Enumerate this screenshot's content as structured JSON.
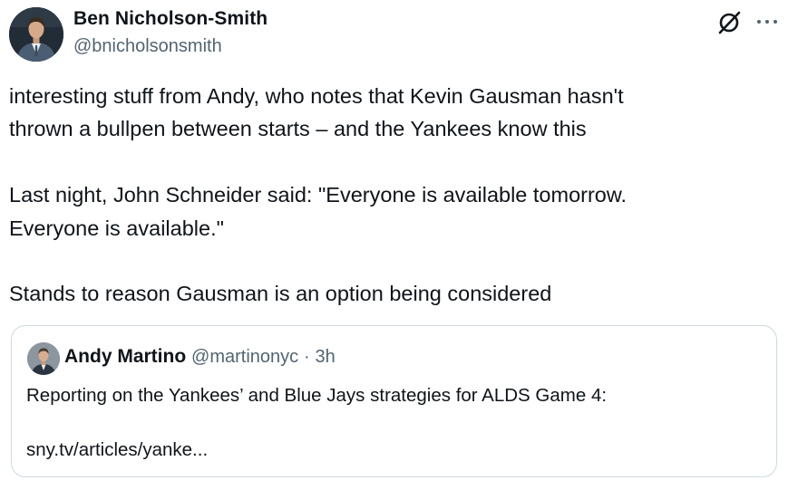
{
  "author": {
    "name": "Ben Nicholson-Smith",
    "handle": "@bnicholsonsmith"
  },
  "header_icons": {
    "grok": "grok-icon",
    "more": "more-icon"
  },
  "tweet": {
    "text": "interesting stuff from Andy, who notes that Kevin Gausman hasn't\nthrown a bullpen between starts – and the Yankees know this\n\nLast night, John Schneider said: \"Everyone is available tomorrow.\nEveryone is available.\"\n\nStands to reason Gausman is an option being considered"
  },
  "quote": {
    "name": "Andy Martino",
    "handle": "@martinonyc",
    "separator": "·",
    "time": "3h",
    "text": "Reporting on the Yankees’ and Blue Jays strategies for ALDS Game 4:\n\nsny.tv/articles/yanke..."
  },
  "colors": {
    "text_primary": "#0f1419",
    "text_secondary": "#536471",
    "border": "#cfd9de"
  }
}
